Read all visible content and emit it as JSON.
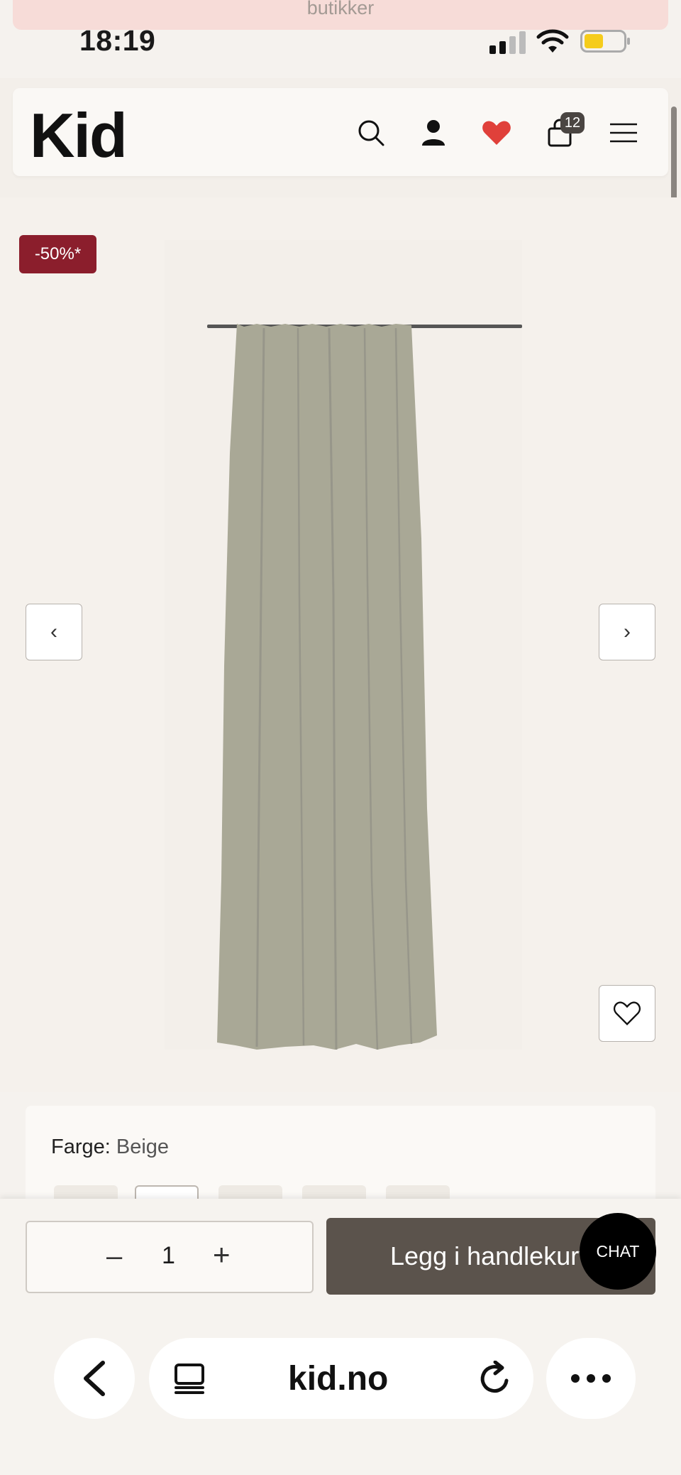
{
  "banner": {
    "text": "butikker"
  },
  "status_bar": {
    "time": "18:19"
  },
  "header": {
    "logo": "Kid",
    "cart_count": "12"
  },
  "product": {
    "discount_badge": "-50%*",
    "prev_label": "‹",
    "next_label": "›",
    "color_label": "Farge:",
    "color_value": "Beige"
  },
  "purchase": {
    "quantity": "1",
    "minus": "–",
    "plus": "+",
    "add_to_cart": "Legg i handlekurv",
    "chat": "CHAT"
  },
  "browser": {
    "url": "kid.no"
  },
  "colors": {
    "discount": "#8b1e2c",
    "add_to_cart_bg": "#5b534c",
    "heart": "#e0403a",
    "curtain": "#a9a896"
  }
}
